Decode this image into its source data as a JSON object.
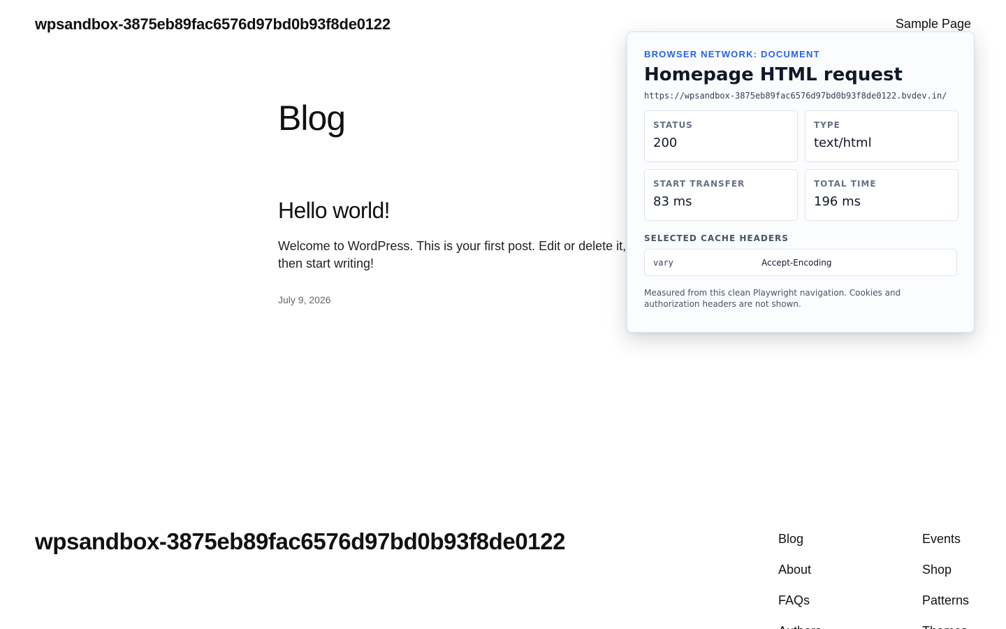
{
  "header": {
    "site_title": "wpsandbox-3875eb89fac6576d97bd0b93f8de0122",
    "nav_link": "Sample Page"
  },
  "main": {
    "heading": "Blog",
    "post": {
      "title": "Hello world!",
      "excerpt": "Welcome to WordPress. This is your first post. Edit or delete it, then start writing!",
      "date": "July 9, 2026"
    }
  },
  "footer": {
    "site_title": "wpsandbox-3875eb89fac6576d97bd0b93f8de0122",
    "col1": [
      "Blog",
      "About",
      "FAQs",
      "Authors"
    ],
    "col2": [
      "Events",
      "Shop",
      "Patterns",
      "Themes"
    ]
  },
  "network_panel": {
    "eyebrow": "Browser network: Document",
    "title": "Homepage HTML request",
    "url": "https://wpsandbox-3875eb89fac6576d97bd0b93f8de0122.bvdev.in/",
    "stats": {
      "status_label": "Status",
      "status_value": "200",
      "type_label": "Type",
      "type_value": "text/html",
      "start_label": "Start transfer",
      "start_value": "83 ms",
      "total_label": "Total time",
      "total_value": "196 ms"
    },
    "cache_label": "Selected cache headers",
    "cache_headers": [
      {
        "key": "vary",
        "value": "Accept-Encoding"
      }
    ],
    "note": "Measured from this clean Playwright navigation. Cookies and authorization headers are not shown."
  },
  "colors": {
    "accent": "#2563eb",
    "text": "#111111",
    "panel_bg": "#fbfcfe",
    "panel_border": "#dde3ec"
  }
}
